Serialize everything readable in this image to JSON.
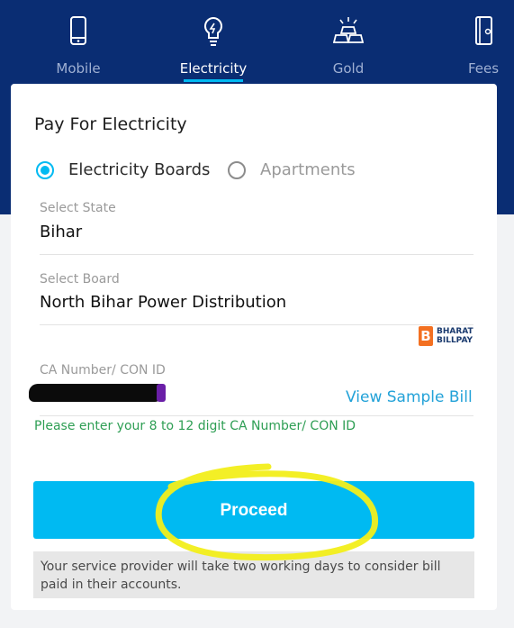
{
  "tabs": [
    {
      "label": "Mobile",
      "icon": "mobile-icon",
      "active": false
    },
    {
      "label": "Electricity",
      "icon": "lightbulb-icon",
      "active": true
    },
    {
      "label": "Gold",
      "icon": "gold-bars-icon",
      "active": false
    },
    {
      "label": "Fees",
      "icon": "fees-book-icon",
      "active": false
    }
  ],
  "form": {
    "title": "Pay For Electricity",
    "options": [
      {
        "label": "Electricity Boards",
        "selected": true
      },
      {
        "label": "Apartments",
        "selected": false
      }
    ],
    "state": {
      "label": "Select State",
      "value": "Bihar"
    },
    "board": {
      "label": "Select Board",
      "value": "North Bihar Power Distribution"
    },
    "bbps": {
      "letter": "B",
      "line1": "BHARAT",
      "line2": "BILLPAY"
    },
    "ca": {
      "label": "CA Number/ CON ID",
      "sample_link": "View Sample Bill"
    },
    "hint": "Please enter your 8 to 12 digit CA Number/ CON ID",
    "proceed_label": "Proceed",
    "note": "Your service provider will take two working days to consider bill paid in their accounts."
  },
  "colors": {
    "header_bg": "#0a2d73",
    "accent": "#00baf2",
    "hint_green": "#2e9e54",
    "link_blue": "#23a2d8",
    "highlight_yellow": "#f2ee1a",
    "bbps_orange": "#f37021"
  }
}
